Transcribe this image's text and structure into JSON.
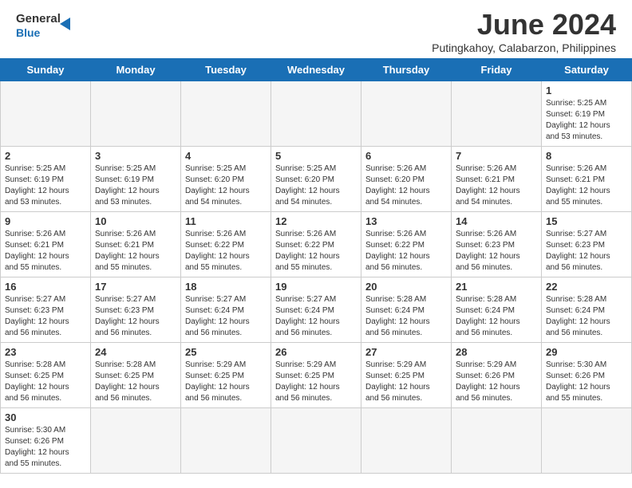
{
  "header": {
    "logo_text_general": "General",
    "logo_text_blue": "Blue",
    "month_title": "June 2024",
    "location": "Putingkahoy, Calabarzon, Philippines"
  },
  "days_of_week": [
    "Sunday",
    "Monday",
    "Tuesday",
    "Wednesday",
    "Thursday",
    "Friday",
    "Saturday"
  ],
  "weeks": [
    [
      {
        "day": "",
        "info": ""
      },
      {
        "day": "",
        "info": ""
      },
      {
        "day": "",
        "info": ""
      },
      {
        "day": "",
        "info": ""
      },
      {
        "day": "",
        "info": ""
      },
      {
        "day": "",
        "info": ""
      },
      {
        "day": "1",
        "info": "Sunrise: 5:25 AM\nSunset: 6:19 PM\nDaylight: 12 hours\nand 53 minutes."
      }
    ],
    [
      {
        "day": "2",
        "info": "Sunrise: 5:25 AM\nSunset: 6:19 PM\nDaylight: 12 hours\nand 53 minutes."
      },
      {
        "day": "3",
        "info": "Sunrise: 5:25 AM\nSunset: 6:19 PM\nDaylight: 12 hours\nand 53 minutes."
      },
      {
        "day": "4",
        "info": "Sunrise: 5:25 AM\nSunset: 6:20 PM\nDaylight: 12 hours\nand 54 minutes."
      },
      {
        "day": "5",
        "info": "Sunrise: 5:25 AM\nSunset: 6:20 PM\nDaylight: 12 hours\nand 54 minutes."
      },
      {
        "day": "6",
        "info": "Sunrise: 5:26 AM\nSunset: 6:20 PM\nDaylight: 12 hours\nand 54 minutes."
      },
      {
        "day": "7",
        "info": "Sunrise: 5:26 AM\nSunset: 6:21 PM\nDaylight: 12 hours\nand 54 minutes."
      },
      {
        "day": "8",
        "info": "Sunrise: 5:26 AM\nSunset: 6:21 PM\nDaylight: 12 hours\nand 55 minutes."
      }
    ],
    [
      {
        "day": "9",
        "info": "Sunrise: 5:26 AM\nSunset: 6:21 PM\nDaylight: 12 hours\nand 55 minutes."
      },
      {
        "day": "10",
        "info": "Sunrise: 5:26 AM\nSunset: 6:21 PM\nDaylight: 12 hours\nand 55 minutes."
      },
      {
        "day": "11",
        "info": "Sunrise: 5:26 AM\nSunset: 6:22 PM\nDaylight: 12 hours\nand 55 minutes."
      },
      {
        "day": "12",
        "info": "Sunrise: 5:26 AM\nSunset: 6:22 PM\nDaylight: 12 hours\nand 55 minutes."
      },
      {
        "day": "13",
        "info": "Sunrise: 5:26 AM\nSunset: 6:22 PM\nDaylight: 12 hours\nand 56 minutes."
      },
      {
        "day": "14",
        "info": "Sunrise: 5:26 AM\nSunset: 6:23 PM\nDaylight: 12 hours\nand 56 minutes."
      },
      {
        "day": "15",
        "info": "Sunrise: 5:27 AM\nSunset: 6:23 PM\nDaylight: 12 hours\nand 56 minutes."
      }
    ],
    [
      {
        "day": "16",
        "info": "Sunrise: 5:27 AM\nSunset: 6:23 PM\nDaylight: 12 hours\nand 56 minutes."
      },
      {
        "day": "17",
        "info": "Sunrise: 5:27 AM\nSunset: 6:23 PM\nDaylight: 12 hours\nand 56 minutes."
      },
      {
        "day": "18",
        "info": "Sunrise: 5:27 AM\nSunset: 6:24 PM\nDaylight: 12 hours\nand 56 minutes."
      },
      {
        "day": "19",
        "info": "Sunrise: 5:27 AM\nSunset: 6:24 PM\nDaylight: 12 hours\nand 56 minutes."
      },
      {
        "day": "20",
        "info": "Sunrise: 5:28 AM\nSunset: 6:24 PM\nDaylight: 12 hours\nand 56 minutes."
      },
      {
        "day": "21",
        "info": "Sunrise: 5:28 AM\nSunset: 6:24 PM\nDaylight: 12 hours\nand 56 minutes."
      },
      {
        "day": "22",
        "info": "Sunrise: 5:28 AM\nSunset: 6:24 PM\nDaylight: 12 hours\nand 56 minutes."
      }
    ],
    [
      {
        "day": "23",
        "info": "Sunrise: 5:28 AM\nSunset: 6:25 PM\nDaylight: 12 hours\nand 56 minutes."
      },
      {
        "day": "24",
        "info": "Sunrise: 5:28 AM\nSunset: 6:25 PM\nDaylight: 12 hours\nand 56 minutes."
      },
      {
        "day": "25",
        "info": "Sunrise: 5:29 AM\nSunset: 6:25 PM\nDaylight: 12 hours\nand 56 minutes."
      },
      {
        "day": "26",
        "info": "Sunrise: 5:29 AM\nSunset: 6:25 PM\nDaylight: 12 hours\nand 56 minutes."
      },
      {
        "day": "27",
        "info": "Sunrise: 5:29 AM\nSunset: 6:25 PM\nDaylight: 12 hours\nand 56 minutes."
      },
      {
        "day": "28",
        "info": "Sunrise: 5:29 AM\nSunset: 6:26 PM\nDaylight: 12 hours\nand 56 minutes."
      },
      {
        "day": "29",
        "info": "Sunrise: 5:30 AM\nSunset: 6:26 PM\nDaylight: 12 hours\nand 55 minutes."
      }
    ],
    [
      {
        "day": "30",
        "info": "Sunrise: 5:30 AM\nSunset: 6:26 PM\nDaylight: 12 hours\nand 55 minutes."
      },
      {
        "day": "",
        "info": ""
      },
      {
        "day": "",
        "info": ""
      },
      {
        "day": "",
        "info": ""
      },
      {
        "day": "",
        "info": ""
      },
      {
        "day": "",
        "info": ""
      },
      {
        "day": "",
        "info": ""
      }
    ]
  ]
}
